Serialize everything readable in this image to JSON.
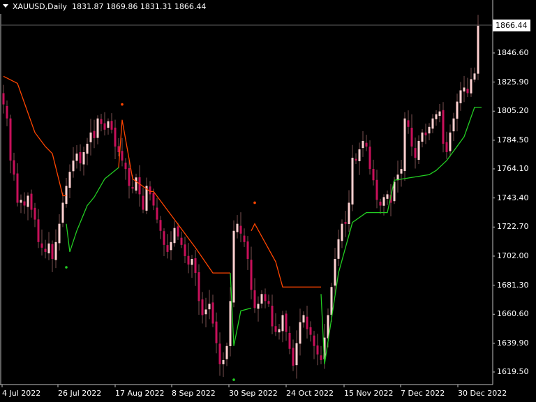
{
  "header": {
    "symbol_timeframe": "XAUUSD,Daily",
    "ohlc": "1831.87 1869.86 1831.31 1866.44"
  },
  "current_price_label": "1866.44",
  "colors": {
    "background": "#000000",
    "bull_candle": "#ffd0d0",
    "bear_candle": "#c8105a",
    "wick": "#7a5050",
    "trail_down": "#ff4500",
    "trail_up": "#22cc22",
    "axis": "#c0c0c0",
    "text": "#ffffff",
    "price_line": "#606060"
  },
  "chart_data": {
    "type": "candlestick",
    "title": "XAUUSD,Daily",
    "ylim": [
      1612,
      1872
    ],
    "yticks": [
      "1866.44",
      "1846.60",
      "1825.90",
      "1805.20",
      "1784.50",
      "1764.10",
      "1743.40",
      "1722.70",
      "1702.00",
      "1681.30",
      "1660.60",
      "1639.90",
      "1619.50"
    ],
    "xticks": [
      "4 Jul 2022",
      "26 Jul 2022",
      "17 Aug 2022",
      "8 Sep 2022",
      "30 Sep 2022",
      "24 Oct 2022",
      "15 Nov 2022",
      "7 Dec 2022",
      "30 Dec 2022"
    ],
    "xtick_bar_index": [
      0,
      16,
      32,
      48,
      65,
      82,
      98,
      114,
      131
    ],
    "closes": [
      1810,
      1800,
      1770,
      1760,
      1740,
      1742,
      1738,
      1745,
      1735,
      1728,
      1712,
      1708,
      1705,
      1711,
      1700,
      1712,
      1725,
      1740,
      1752,
      1762,
      1770,
      1775,
      1768,
      1776,
      1782,
      1790,
      1786,
      1800,
      1796,
      1792,
      1798,
      1792,
      1780,
      1776,
      1770,
      1764,
      1752,
      1750,
      1758,
      1746,
      1735,
      1752,
      1746,
      1738,
      1728,
      1720,
      1710,
      1705,
      1712,
      1722,
      1716,
      1710,
      1702,
      1696,
      1700,
      1690,
      1670,
      1660,
      1664,
      1668,
      1654,
      1640,
      1625,
      1628,
      1638,
      1670,
      1720,
      1725,
      1718,
      1712,
      1700,
      1678,
      1665,
      1668,
      1675,
      1670,
      1668,
      1652,
      1648,
      1650,
      1660,
      1648,
      1636,
      1624,
      1640,
      1655,
      1660,
      1650,
      1646,
      1638,
      1632,
      1628,
      1644,
      1660,
      1680,
      1700,
      1714,
      1725,
      1725,
      1740,
      1772,
      1770,
      1778,
      1784,
      1780,
      1764,
      1756,
      1742,
      1738,
      1744,
      1746,
      1740,
      1755,
      1760,
      1764,
      1800,
      1794,
      1780,
      1772,
      1784,
      1790,
      1788,
      1794,
      1800,
      1803,
      1805,
      1782,
      1776,
      1790,
      1800,
      1812,
      1820,
      1822,
      1818,
      1828,
      1832,
      1866
    ],
    "series": [
      {
        "name": "Bullish candles",
        "color": "#ffd0d0"
      },
      {
        "name": "Bearish candles",
        "color": "#c8105a"
      },
      {
        "name": "Trailing stop (down)",
        "color": "#ff4500"
      },
      {
        "name": "Trailing stop (up)",
        "color": "#22cc22"
      }
    ],
    "signal_dots": [
      {
        "type": "up",
        "bar": 18,
        "price": 1694
      },
      {
        "type": "down",
        "bar": 34,
        "price": 1810
      },
      {
        "type": "up",
        "bar": 66,
        "price": 1614
      },
      {
        "type": "down",
        "bar": 72,
        "price": 1740
      }
    ]
  }
}
